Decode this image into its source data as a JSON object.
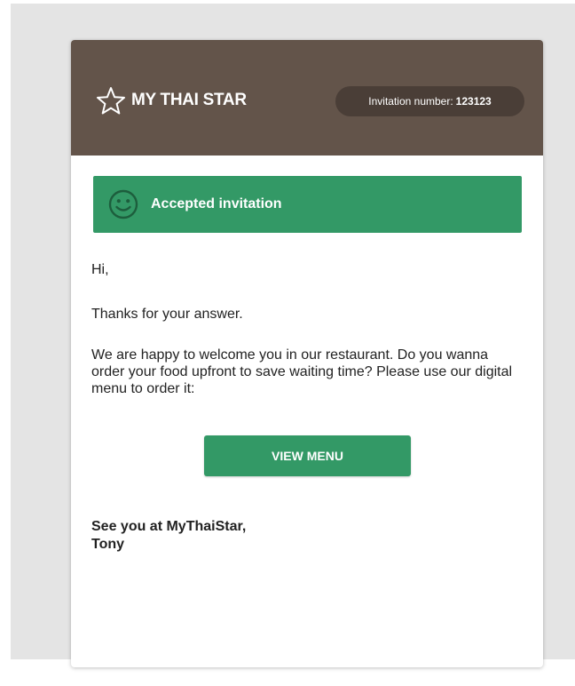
{
  "header": {
    "brand_title": "MY THAI STAR",
    "invitation_label": "Invitation number:",
    "invitation_number": "123123"
  },
  "status": {
    "text": "Accepted invitation",
    "icon": "smiley-face-icon"
  },
  "body": {
    "greeting": "Hi,",
    "thanks": "Thanks for your answer.",
    "message": "We are happy to welcome you in our restaurant. Do you wanna order your food upfront to save waiting time? Please use our digital menu to order it:"
  },
  "actions": {
    "view_menu_label": "VIEW MENU"
  },
  "signoff": {
    "line1": "See you at MyThaiStar,",
    "line2": "Tony"
  },
  "colors": {
    "header_bg": "#63544a",
    "pill_bg": "#4a3e37",
    "accent_green": "#339966",
    "page_bg": "#e4e4e4"
  }
}
